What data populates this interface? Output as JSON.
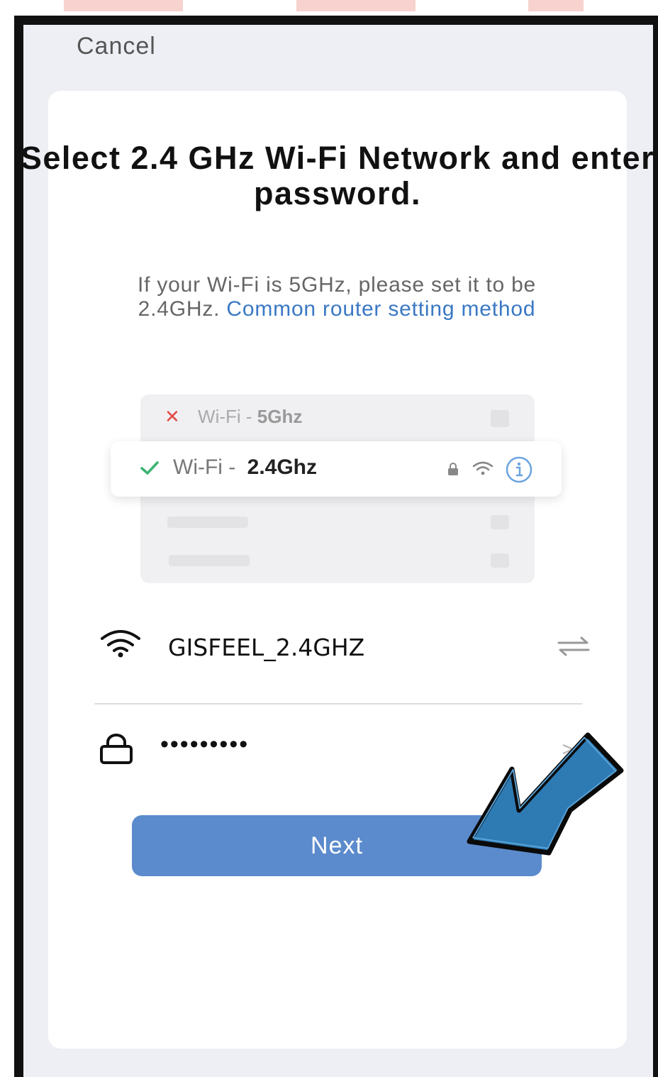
{
  "header": {
    "cancel_label": "Cancel"
  },
  "main": {
    "title": "Select 2.4 GHz Wi-Fi Network and enter password.",
    "subtitle_text": "If your Wi-Fi is 5GHz, please set it to be 2.4GHz.",
    "subtitle_link": "Common router setting method"
  },
  "illustration": {
    "bad_prefix": "Wi-Fi -",
    "bad_band": "5Ghz",
    "good_prefix": "Wi-Fi -",
    "good_band": "2.4Ghz"
  },
  "form": {
    "ssid_value": "GISFEEL_2.4GHZ",
    "password_masked": "•••••••••"
  },
  "actions": {
    "next_label": "Next"
  },
  "colors": {
    "accent": "#5b8bcc",
    "link": "#3a78c4",
    "error": "#e24b47",
    "success": "#3cb371",
    "annotation_arrow": "#2e7bb4"
  },
  "icons": [
    "close-icon",
    "check-icon",
    "lock-icon",
    "wifi-icon",
    "info-icon",
    "switch-network-icon",
    "chevron-right-icon",
    "annotation-arrow-icon"
  ]
}
